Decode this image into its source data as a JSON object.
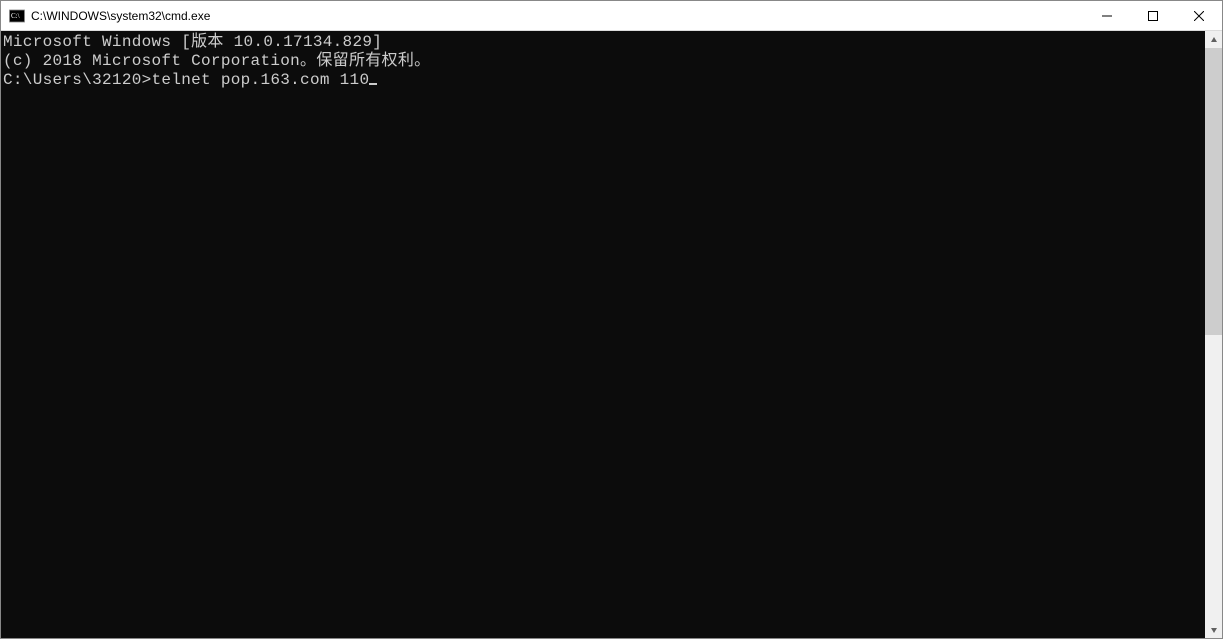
{
  "window": {
    "title": "C:\\WINDOWS\\system32\\cmd.exe"
  },
  "terminal": {
    "line1": "Microsoft Windows [版本 10.0.17134.829]",
    "line2": "(c) 2018 Microsoft Corporation。保留所有权利。",
    "blank": "",
    "prompt": "C:\\Users\\32120>",
    "command": "telnet pop.163.com 110"
  }
}
